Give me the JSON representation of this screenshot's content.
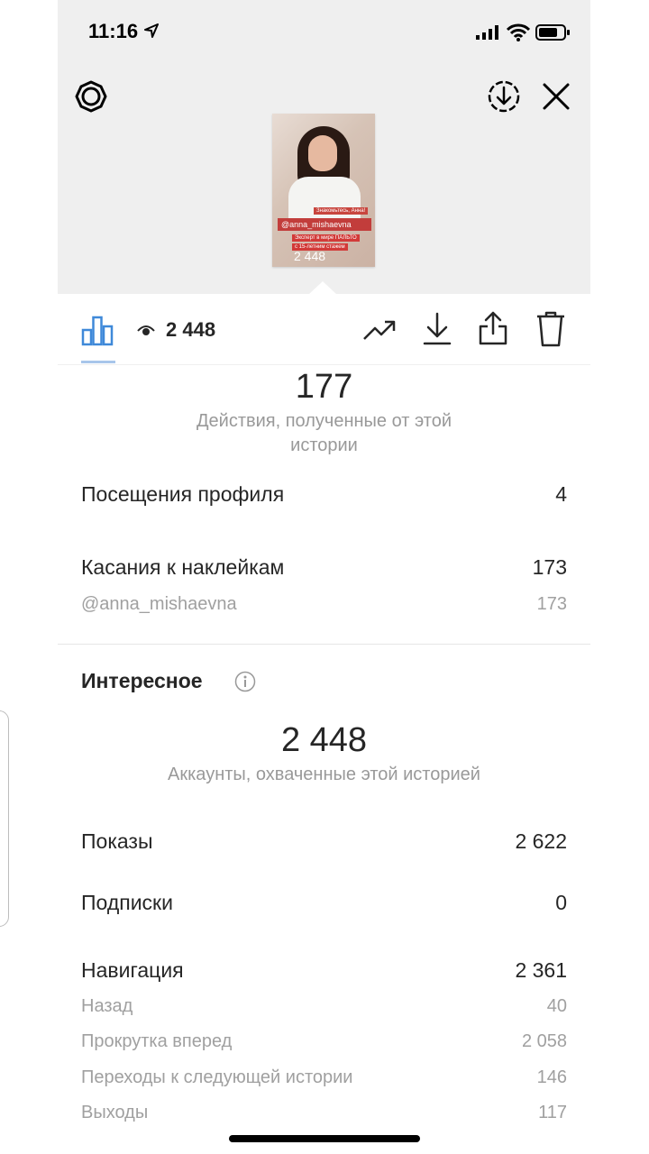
{
  "status_bar": {
    "time": "11:16"
  },
  "story": {
    "sticker_main": "@anna_mishaevna",
    "sticker_small_1": "Знакомьтесь, Анна!",
    "sticker_small_2": "Эксперт в мире ПАЛЬТО",
    "sticker_small_3": "с 15-летним стажем",
    "views_overlay": "2 448"
  },
  "toolbar": {
    "view_count": "2 448"
  },
  "actions": {
    "value": "177",
    "caption": "Действия, полученные от этой истории"
  },
  "stats_actions": [
    {
      "label": "Посещения профиля",
      "value": "4"
    },
    {
      "label": "Касания к наклейкам",
      "value": "173"
    }
  ],
  "sticker_detail": {
    "label": "@anna_mishaevna",
    "value": "173"
  },
  "discovery": {
    "title": "Интересное",
    "value": "2 448",
    "caption": "Аккаунты, охваченные этой историей",
    "rows": [
      {
        "label": "Показы",
        "value": "2 622"
      },
      {
        "label": "Подписки",
        "value": "0"
      },
      {
        "label": "Навигация",
        "value": "2 361"
      }
    ],
    "navigation_details": [
      {
        "label": "Назад",
        "value": "40"
      },
      {
        "label": "Прокрутка вперед",
        "value": "2 058"
      },
      {
        "label": "Переходы к следующей истории",
        "value": "146"
      },
      {
        "label": "Выходы",
        "value": "117"
      }
    ]
  }
}
